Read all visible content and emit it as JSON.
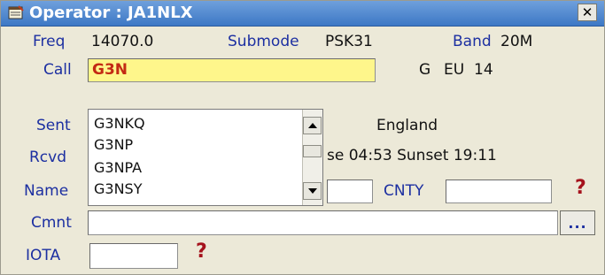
{
  "window": {
    "title": "Operator : JA1NLX",
    "close_label": "✕"
  },
  "row1": {
    "freq_label": "Freq",
    "freq_value": "14070.0",
    "submode_label": "Submode",
    "submode_value": "PSK31",
    "band_label": "Band",
    "band_value": "20M"
  },
  "row2": {
    "call_label": "Call",
    "call_value": "G3N",
    "country_prefix": "G",
    "continent": "EU",
    "zone": "14"
  },
  "row3": {
    "sent_label": "Sent",
    "country_name": "England"
  },
  "row4": {
    "rcvd_label": "Rcvd",
    "sun_text": "se 04:53 Sunset 19:11"
  },
  "row5": {
    "name_label": "Name",
    "cnty_label": "CNTY",
    "question_mark": "?"
  },
  "row6": {
    "cmnt_label": "Cmnt",
    "ellipsis_label": "..."
  },
  "row7": {
    "iota_label": "IOTA",
    "question_mark": "?"
  },
  "autocomplete": {
    "items": [
      "G3NKQ",
      "G3NP",
      "G3NPA",
      "G3NSY"
    ]
  },
  "colors": {
    "label_blue": "#1c2fa1",
    "call_bg": "#fef68b",
    "call_text": "#c32a14",
    "question_red": "#a5121c",
    "title_bar": "#3d78c5"
  }
}
